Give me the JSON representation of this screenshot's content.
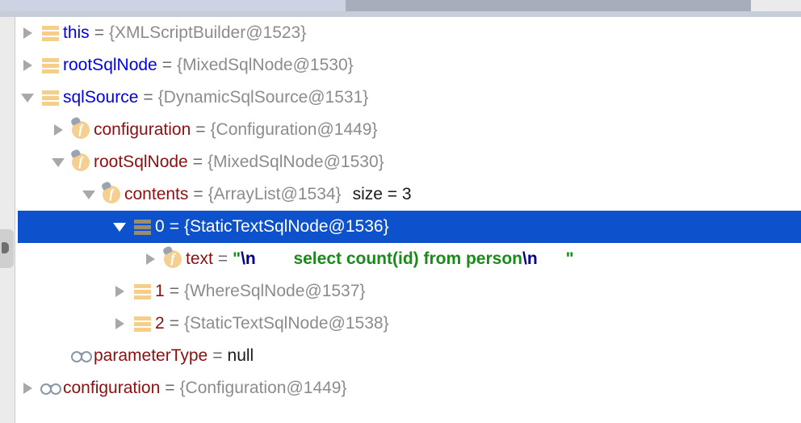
{
  "window": {
    "scrollbar": {
      "orientation": "horizontal",
      "thumb_position": "right"
    }
  },
  "colors": {
    "selection_background": "#0d52cc",
    "selection_foreground": "#ffffff",
    "local_variable_name": "#0000ee",
    "field_name": "#8b1111",
    "object_reference": "#8c8c8c",
    "string_literal": "#1a8a1a",
    "escape_sequence": "#00008b",
    "list_icon": "#f5ce8a",
    "field_icon": "#f5cf92",
    "glasses_icon": "#8a97a8",
    "gutter": "#ebebeb"
  },
  "gutter": {
    "handle_label": "collapsed-tool-window-handle"
  },
  "tree": {
    "rows": [
      {
        "id": "this",
        "depth": 0,
        "twisty": "collapsed",
        "icon": "list-icon",
        "name": "this",
        "name_kind": "local",
        "equals": "=",
        "value": "{XMLScriptBuilder@1523}",
        "value_kind": "reference",
        "selected": false
      },
      {
        "id": "rootSqlNode-top",
        "depth": 0,
        "twisty": "collapsed",
        "icon": "list-icon",
        "name": "rootSqlNode",
        "name_kind": "local",
        "equals": "=",
        "value": "{MixedSqlNode@1530}",
        "value_kind": "reference",
        "selected": false
      },
      {
        "id": "sqlSource",
        "depth": 0,
        "twisty": "expanded",
        "icon": "list-icon",
        "name": "sqlSource",
        "name_kind": "local",
        "equals": "=",
        "value": "{DynamicSqlSource@1531}",
        "value_kind": "reference",
        "selected": false
      },
      {
        "id": "configuration-nested",
        "depth": 1,
        "twisty": "collapsed",
        "icon": "field-icon",
        "name": "configuration",
        "name_kind": "field",
        "equals": "=",
        "value": "{Configuration@1449}",
        "value_kind": "reference",
        "selected": false
      },
      {
        "id": "rootSqlNode-nested",
        "depth": 1,
        "twisty": "expanded",
        "icon": "field-icon",
        "name": "rootSqlNode",
        "name_kind": "field",
        "equals": "=",
        "value": "{MixedSqlNode@1530}",
        "value_kind": "reference",
        "selected": false
      },
      {
        "id": "contents",
        "depth": 2,
        "twisty": "expanded",
        "icon": "field-icon",
        "name": "contents",
        "name_kind": "field",
        "equals": "=",
        "value": "{ArrayList@1534}",
        "value_kind": "reference",
        "extra": "size = 3",
        "selected": false
      },
      {
        "id": "item-0",
        "depth": 3,
        "twisty": "expanded",
        "icon": "list-icon",
        "name": "0",
        "name_kind": "index",
        "equals": "=",
        "value": "{StaticTextSqlNode@1536}",
        "value_kind": "reference",
        "selected": true
      },
      {
        "id": "text",
        "depth": 4,
        "twisty": "collapsed",
        "icon": "field-icon",
        "name": "text",
        "name_kind": "field",
        "equals": "=",
        "value_kind": "string",
        "string_parts": [
          {
            "kind": "quote",
            "text": "\""
          },
          {
            "kind": "escape",
            "text": "\\n"
          },
          {
            "kind": "space",
            "text": "        "
          },
          {
            "kind": "body",
            "text": "select count(id) from person"
          },
          {
            "kind": "escape",
            "text": "\\n"
          },
          {
            "kind": "space",
            "text": "      "
          },
          {
            "kind": "quote",
            "text": "\""
          }
        ],
        "selected": false
      },
      {
        "id": "item-1",
        "depth": 3,
        "twisty": "collapsed",
        "icon": "list-icon",
        "name": "1",
        "name_kind": "index",
        "equals": "=",
        "value": "{WhereSqlNode@1537}",
        "value_kind": "reference",
        "selected": false
      },
      {
        "id": "item-2",
        "depth": 3,
        "twisty": "collapsed",
        "icon": "list-icon",
        "name": "2",
        "name_kind": "index",
        "equals": "=",
        "value": "{StaticTextSqlNode@1538}",
        "value_kind": "reference",
        "selected": false
      },
      {
        "id": "parameterType",
        "depth": 1,
        "twisty": "none",
        "icon": "glasses-icon",
        "name": "parameterType",
        "name_kind": "field",
        "equals": "=",
        "value": "null",
        "value_kind": "null",
        "selected": false
      },
      {
        "id": "configuration-root",
        "depth": 0,
        "twisty": "collapsed",
        "icon": "glasses-icon",
        "name": "configuration",
        "name_kind": "field",
        "equals": "=",
        "value": "{Configuration@1449}",
        "value_kind": "reference",
        "selected": false
      }
    ]
  }
}
